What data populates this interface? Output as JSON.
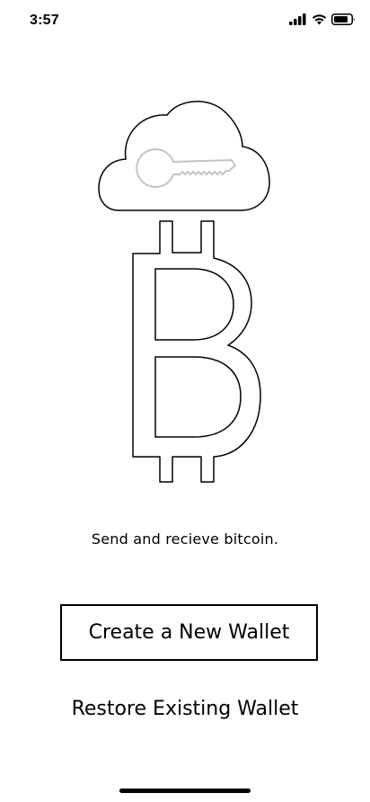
{
  "status_bar": {
    "time": "3:57",
    "icons": [
      "signal-icon",
      "wifi-icon",
      "battery-icon"
    ]
  },
  "hero": {
    "icons": [
      "cloud-icon",
      "key-icon",
      "bitcoin-icon"
    ],
    "colors": {
      "outline": "#000000",
      "key": "#c4c4c4"
    }
  },
  "tagline": "Send and recieve bitcoin.",
  "actions": {
    "create_label": "Create a New Wallet",
    "restore_label": "Restore Existing Wallet"
  }
}
